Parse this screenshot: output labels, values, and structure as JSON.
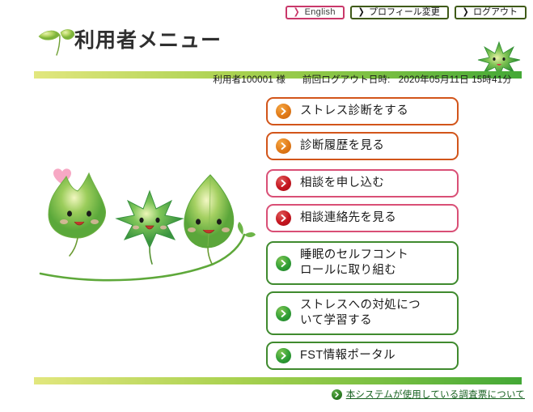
{
  "topnav": [
    {
      "label": "English",
      "icon": "chevron-right-icon",
      "style": "english"
    },
    {
      "label": "プロフィール変更",
      "icon": "chevron-right-icon",
      "style": "dark"
    },
    {
      "label": "ログアウト",
      "icon": "chevron-right-icon",
      "style": "dark"
    }
  ],
  "header": {
    "title": "利用者メニュー",
    "logo_icon": "leaf-sprout-icon",
    "corner_icon": "maple-leaf-character-icon"
  },
  "userinfo": {
    "user_label": "利用者100001 様",
    "last_logout_label": "前回ログアウト日時:",
    "last_logout_value": "2020年05月11日 15時41分"
  },
  "illustration": {
    "name": "three-leaf-characters-illustration",
    "heart_icon": "pink-heart-icon",
    "characters": [
      "ivy-leaf-character",
      "maple-leaf-character",
      "willow-leaf-character"
    ]
  },
  "menu": [
    {
      "label": "ストレス診断をする",
      "color": "orange",
      "lines": 1
    },
    {
      "label": "診断履歴を見る",
      "color": "orange",
      "lines": 1
    },
    {
      "label": "相談を申し込む",
      "color": "pink",
      "lines": 1
    },
    {
      "label": "相談連絡先を見る",
      "color": "pink",
      "lines": 1
    },
    {
      "label": "睡眠のセルフコント\nロールに取り組む",
      "color": "green",
      "lines": 2
    },
    {
      "label": "ストレスへの対処につ\nいて学習する",
      "color": "green",
      "lines": 2
    },
    {
      "label": "FST情報ポータル",
      "color": "green",
      "lines": 1
    }
  ],
  "footer": {
    "link_label": "本システムが使用している調査票について",
    "link_icon": "chevron-right-circle-icon"
  },
  "colors": {
    "orange_border": "#d2551a",
    "pink_border": "#d94f76",
    "green_border": "#3f8a2e",
    "english_border": "#c9386a",
    "dark_border": "#3f5a18",
    "link_green": "#135f1c",
    "rule_gradient_start": "#e2e77e",
    "rule_gradient_end": "#43a836"
  }
}
